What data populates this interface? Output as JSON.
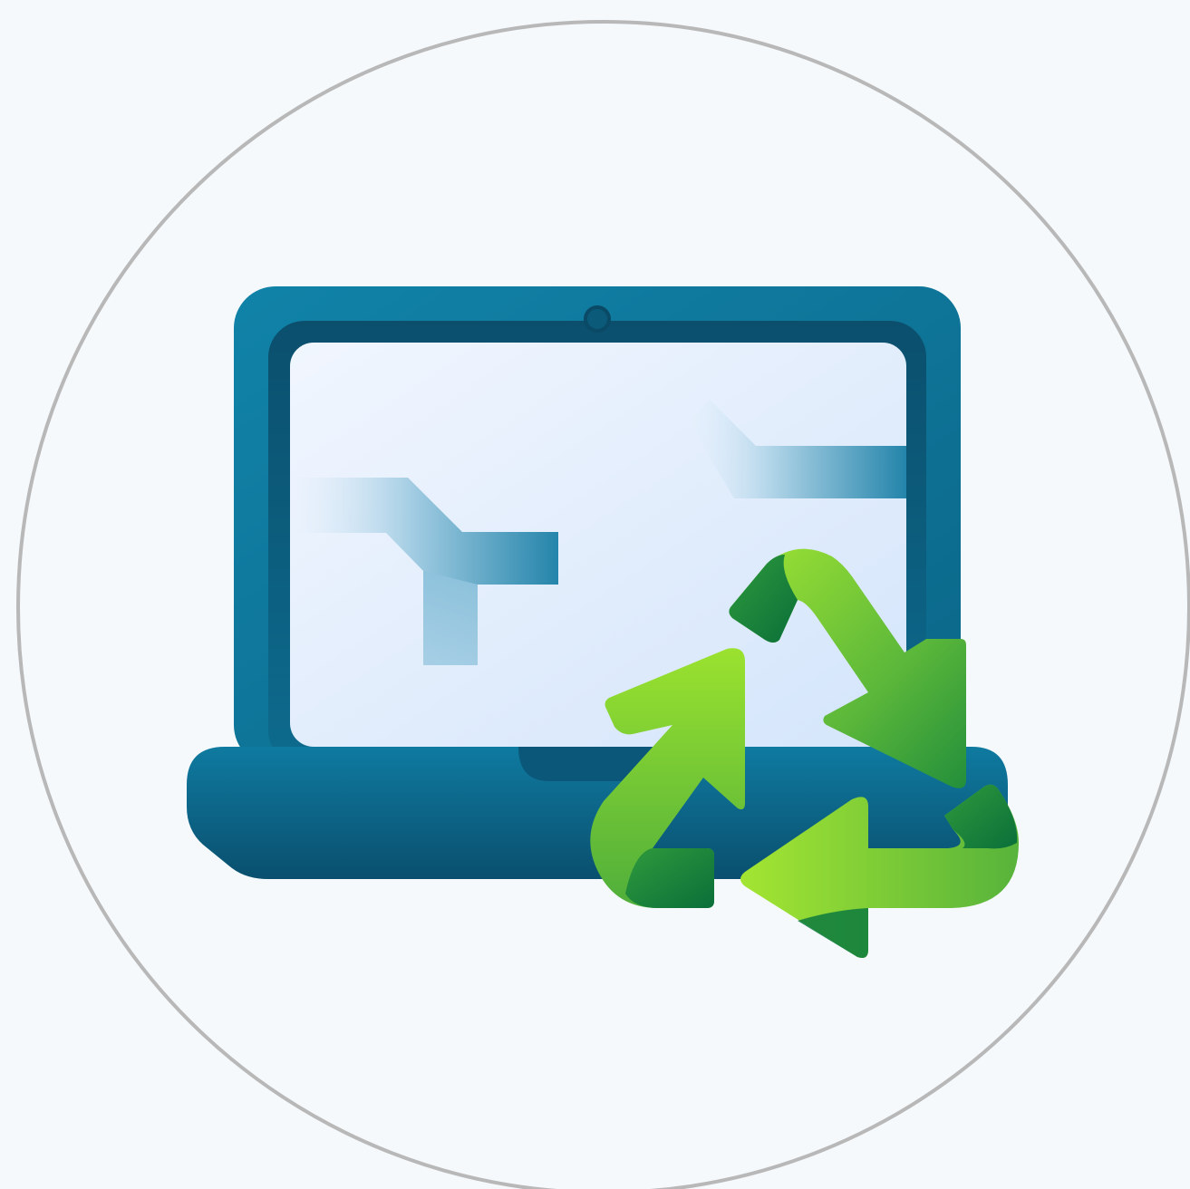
{
  "illustration": {
    "subject": "laptop-with-recycle-arrows",
    "icons": [
      "circle-frame",
      "laptop-icon",
      "recycle-icon"
    ],
    "colors": {
      "background": "#f5f9fc",
      "circle_stroke": "#b8b8b8",
      "laptop_dark": "#0a4d6a",
      "laptop_mid": "#0e6f92",
      "laptop_light": "#1181a8",
      "screen_light": "#eef4fd",
      "screen_blue": "#d7e7fb",
      "recycle_light": "#9be22f",
      "recycle_mid": "#52b43c",
      "recycle_dark": "#0b7b3e"
    }
  }
}
